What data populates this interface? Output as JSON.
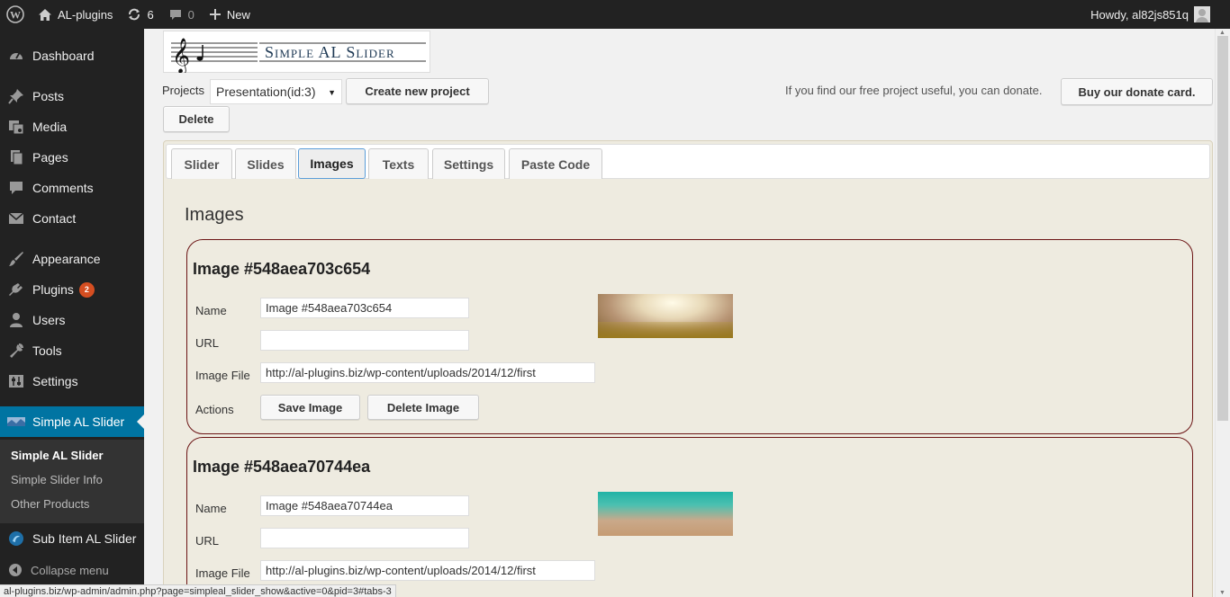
{
  "admin_bar": {
    "site_name": "AL-plugins",
    "updates_count": "6",
    "comments_count": "0",
    "new_label": "New",
    "howdy": "Howdy, al82js851q"
  },
  "sidebar": {
    "items": [
      {
        "label": "Dashboard",
        "icon": "dashboard-icon"
      },
      {
        "label": "Posts",
        "icon": "pin-icon"
      },
      {
        "label": "Media",
        "icon": "media-icon"
      },
      {
        "label": "Pages",
        "icon": "pages-icon"
      },
      {
        "label": "Comments",
        "icon": "comment-icon"
      },
      {
        "label": "Contact",
        "icon": "envelope-icon"
      },
      {
        "label": "Appearance",
        "icon": "brush-icon"
      },
      {
        "label": "Plugins",
        "icon": "plug-icon",
        "badge": "2"
      },
      {
        "label": "Users",
        "icon": "user-icon"
      },
      {
        "label": "Tools",
        "icon": "wrench-icon"
      },
      {
        "label": "Settings",
        "icon": "sliders-icon"
      },
      {
        "label": "Simple AL Slider",
        "icon": "slider-icon"
      },
      {
        "label": "Sub Item AL Slider",
        "icon": "sub-item-icon"
      }
    ],
    "submenu": [
      "Simple AL Slider",
      "Simple Slider Info",
      "Other Products"
    ],
    "collapse_label": "Collapse menu"
  },
  "header": {
    "logo_text": "Simple AL Slider",
    "projects_label": "Projects",
    "project_selected": "Presentation(id:3)",
    "create_button": "Create new project",
    "delete_button": "Delete",
    "donate_text": "If you find our free project useful, you can donate.",
    "donate_button": "Buy our donate card."
  },
  "tabs": [
    "Slider",
    "Slides",
    "Images",
    "Texts",
    "Settings",
    "Paste Code"
  ],
  "active_tab": "Images",
  "images_title": "Images",
  "labels": {
    "name": "Name",
    "url": "URL",
    "image_file": "Image File",
    "actions": "Actions",
    "save": "Save Image",
    "delete": "Delete Image"
  },
  "images": [
    {
      "title": "Image #548aea703c654",
      "name": "Image #548aea703c654",
      "url": "",
      "file": "http://al-plugins.biz/wp-content/uploads/2014/12/first"
    },
    {
      "title": "Image #548aea70744ea",
      "name": "Image #548aea70744ea",
      "url": "",
      "file": "http://al-plugins.biz/wp-content/uploads/2014/12/first"
    }
  ],
  "status_url": "al-plugins.biz/wp-admin/admin.php?page=simpleal_slider_show&active=0&pid=3#tabs-3",
  "colors": {
    "admin_bar": "#222222",
    "current_menu": "#0074a2",
    "panel_bg": "#eeebe0",
    "card_border": "#6b1414",
    "badge": "#d54e21"
  }
}
